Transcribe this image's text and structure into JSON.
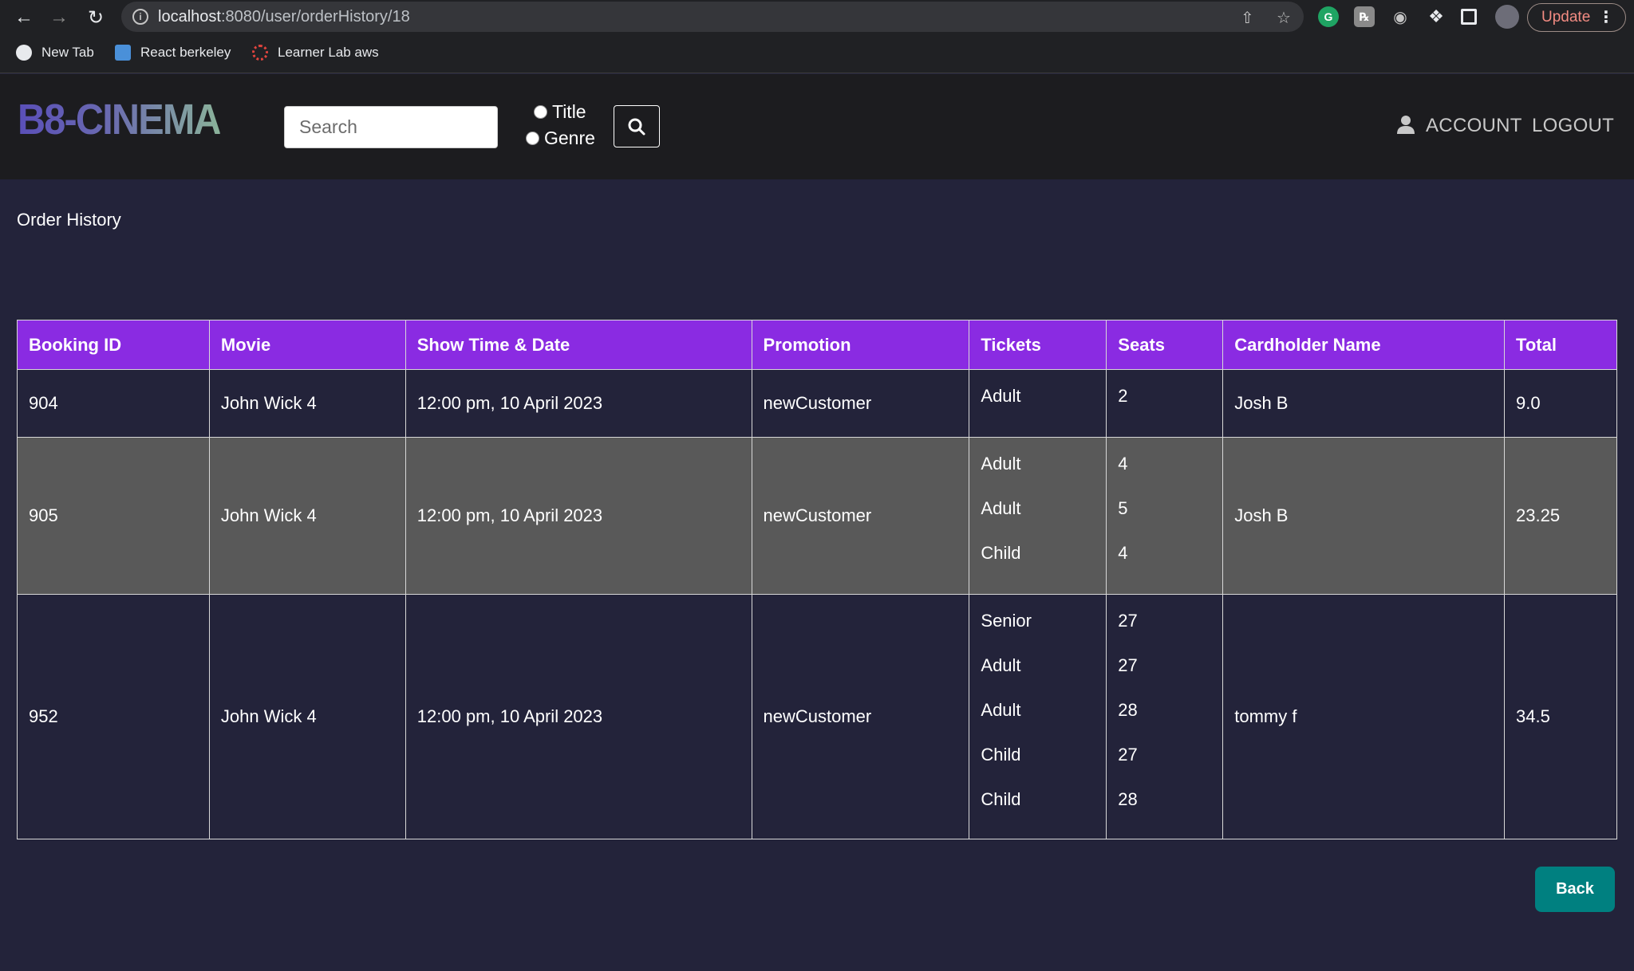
{
  "browser": {
    "url_host": "localhost",
    "url_path": ":8080/user/orderHistory/18",
    "update_label": "Update",
    "bookmarks": [
      {
        "label": "New Tab"
      },
      {
        "label": "React berkeley"
      },
      {
        "label": "Learner Lab aws"
      }
    ]
  },
  "header": {
    "logo": "B8-CINEMA",
    "search_placeholder": "Search",
    "radio_title": "Title",
    "radio_genre": "Genre",
    "account_label": "ACCOUNT",
    "logout_label": "LOGOUT"
  },
  "page": {
    "title": "Order History",
    "back_label": "Back"
  },
  "table": {
    "columns": [
      "Booking ID",
      "Movie",
      "Show Time & Date",
      "Promotion",
      "Tickets",
      "Seats",
      "Cardholder Name",
      "Total"
    ],
    "rows": [
      {
        "booking_id": "904",
        "movie": "John Wick 4",
        "showtime": "12:00 pm, 10 April 2023",
        "promotion": "newCustomer",
        "tickets": [
          "Adult"
        ],
        "seats": [
          "2"
        ],
        "cardholder": "Josh B",
        "total": "9.0"
      },
      {
        "booking_id": "905",
        "movie": "John Wick 4",
        "showtime": "12:00 pm, 10 April 2023",
        "promotion": "newCustomer",
        "tickets": [
          "Adult",
          "Adult",
          "Child"
        ],
        "seats": [
          "4",
          "5",
          "4"
        ],
        "cardholder": "Josh B",
        "total": "23.25"
      },
      {
        "booking_id": "952",
        "movie": "John Wick 4",
        "showtime": "12:00 pm, 10 April 2023",
        "promotion": "newCustomer",
        "tickets": [
          "Senior",
          "Adult",
          "Adult",
          "Child",
          "Child"
        ],
        "seats": [
          "27",
          "27",
          "28",
          "27",
          "28"
        ],
        "cardholder": "tommy f",
        "total": "34.5"
      }
    ]
  },
  "colors": {
    "header_purple": "#8a2be2",
    "back_teal": "#008080",
    "page_bg": "#23233a",
    "alt_row": "#595959"
  }
}
